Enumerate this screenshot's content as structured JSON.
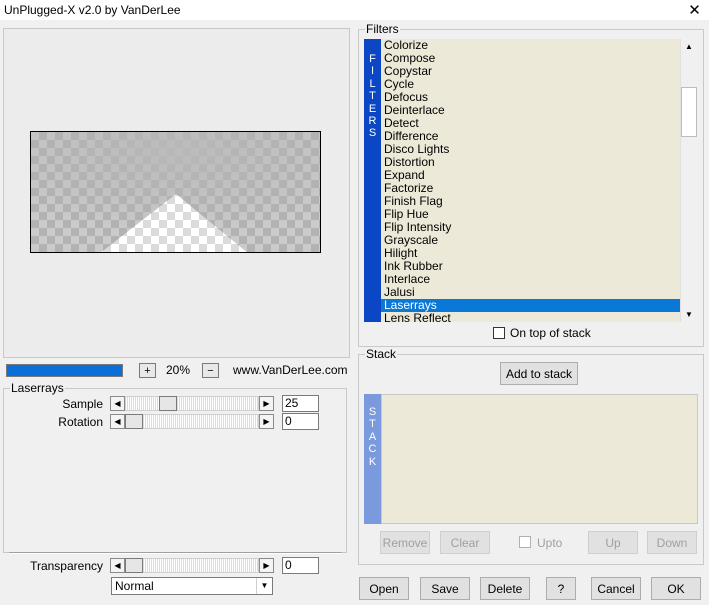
{
  "window": {
    "title": "UnPlugged-X v2.0 by VanDerLee",
    "close_symbol": "✕"
  },
  "preview": {
    "zoom_in": "+",
    "zoom_level": "20%",
    "zoom_out": "−",
    "website": "www.VanDerLee.com",
    "progress": 1.0,
    "progress_color": "#0a6fd8"
  },
  "filter_panel": {
    "title": "Laserrays",
    "params": [
      {
        "label": "Sample",
        "value": "25",
        "level": 0.29
      },
      {
        "label": "Rotation",
        "value": "0",
        "level": 0.0
      }
    ],
    "transparency": {
      "label": "Transparency",
      "value": "0",
      "level": 0.0
    },
    "blend_mode": "Normal"
  },
  "filters": {
    "title": "Filters",
    "band_letters": [
      "F",
      "I",
      "L",
      "T",
      "E",
      "R",
      "S"
    ],
    "items": [
      "Colorize",
      "Compose",
      "Copystar",
      "Cycle",
      "Defocus",
      "Deinterlace",
      "Detect",
      "Difference",
      "Disco Lights",
      "Distortion",
      "Expand",
      "Factorize",
      "Finish Flag",
      "Flip Hue",
      "Flip Intensity",
      "Grayscale",
      "Hilight",
      "Ink Rubber",
      "Interlace",
      "Jalusi",
      "Laserrays",
      "Lens Reflect"
    ],
    "selected": "Laserrays",
    "selected_color": "#0a78d7",
    "band_color": "#0b47c4",
    "on_top_label": "On top of stack"
  },
  "stack": {
    "title": "Stack",
    "add_button": "Add to stack",
    "band_letters": [
      "S",
      "T",
      "A",
      "C",
      "K"
    ],
    "band_color": "#7b9ade",
    "buttons": {
      "remove": "Remove",
      "clear": "Clear",
      "upto": "Upto",
      "up": "Up",
      "down": "Down"
    }
  },
  "footer": {
    "open": "Open",
    "save": "Save",
    "delete": "Delete",
    "help": "?",
    "cancel": "Cancel",
    "ok": "OK"
  },
  "icons": {
    "close": "close-icon",
    "arrow_left": "arrow-left-icon",
    "arrow_right": "arrow-right-icon",
    "arrow_up": "arrow-up-icon",
    "arrow_down": "arrow-down-icon",
    "dropdown": "chevron-down-icon"
  }
}
